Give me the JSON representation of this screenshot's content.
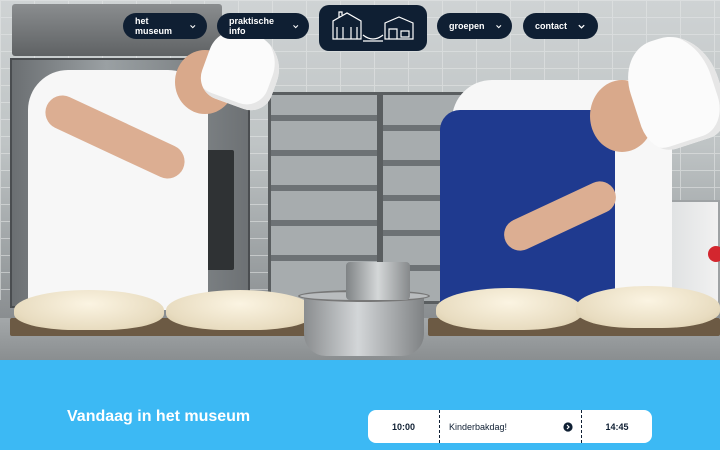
{
  "nav": {
    "items": [
      {
        "label": "het museum"
      },
      {
        "label": "praktische info"
      },
      {
        "label": "groepen"
      },
      {
        "label": "contact"
      }
    ],
    "logo": "museum-logo"
  },
  "hero": {
    "image": "bakers-scoring-dough-photo"
  },
  "today": {
    "title": "Vandaag in het museum",
    "start_time": "10:00",
    "event": "Kinderbakdag!",
    "end_time": "14:45"
  },
  "colors": {
    "nav_bg": "#0f1f33",
    "band_bg": "#3cb9f4",
    "text_light": "#ffffff"
  }
}
